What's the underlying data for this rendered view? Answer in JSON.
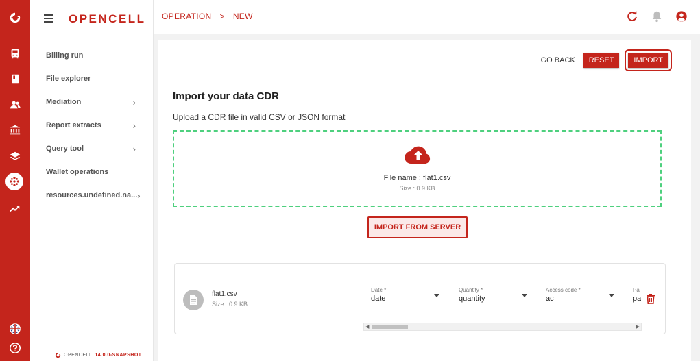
{
  "app": {
    "logo_text": "OPENCELL",
    "version_label": "OPENCELL",
    "version_number": "14.0.0-SNAPSHOT"
  },
  "colors": {
    "brand": "#c4251c",
    "dropzone_border": "#4ed07e"
  },
  "rail": {
    "icons": [
      "logo-icon",
      "bus-icon",
      "book-icon",
      "people-icon",
      "bank-icon",
      "layers-icon",
      "dots-icon",
      "trending-icon",
      "language-flag-icon",
      "help-icon"
    ]
  },
  "sidebar": {
    "items": [
      {
        "label": "Billing run",
        "has_submenu": false
      },
      {
        "label": "File explorer",
        "has_submenu": false
      },
      {
        "label": "Mediation",
        "has_submenu": true
      },
      {
        "label": "Report extracts",
        "has_submenu": true
      },
      {
        "label": "Query tool",
        "has_submenu": true
      },
      {
        "label": "Wallet operations",
        "has_submenu": false
      },
      {
        "label": "resources.undefined.na...",
        "has_submenu": true
      }
    ],
    "chevron": "›"
  },
  "breadcrumb": {
    "parent": "OPERATION",
    "separator": ">",
    "current": "NEW"
  },
  "actions": {
    "go_back": "GO BACK",
    "reset": "RESET",
    "import": "IMPORT"
  },
  "main": {
    "title": "Import your data CDR",
    "subtitle": "Upload a CDR file in valid CSV or JSON format",
    "dropzone": {
      "file_name": "File name : flat1.csv",
      "file_size": "Size : 0.9 KB"
    },
    "import_server_label": "IMPORT FROM SERVER"
  },
  "file_card": {
    "name": "flat1.csv",
    "size": "Size : 0.9 KB",
    "fields": [
      {
        "label": "Date *",
        "value": "date"
      },
      {
        "label": "Quantity *",
        "value": "quantity"
      },
      {
        "label": "Access code *",
        "value": "ac"
      },
      {
        "label": "Pa",
        "value": "pa"
      }
    ]
  }
}
